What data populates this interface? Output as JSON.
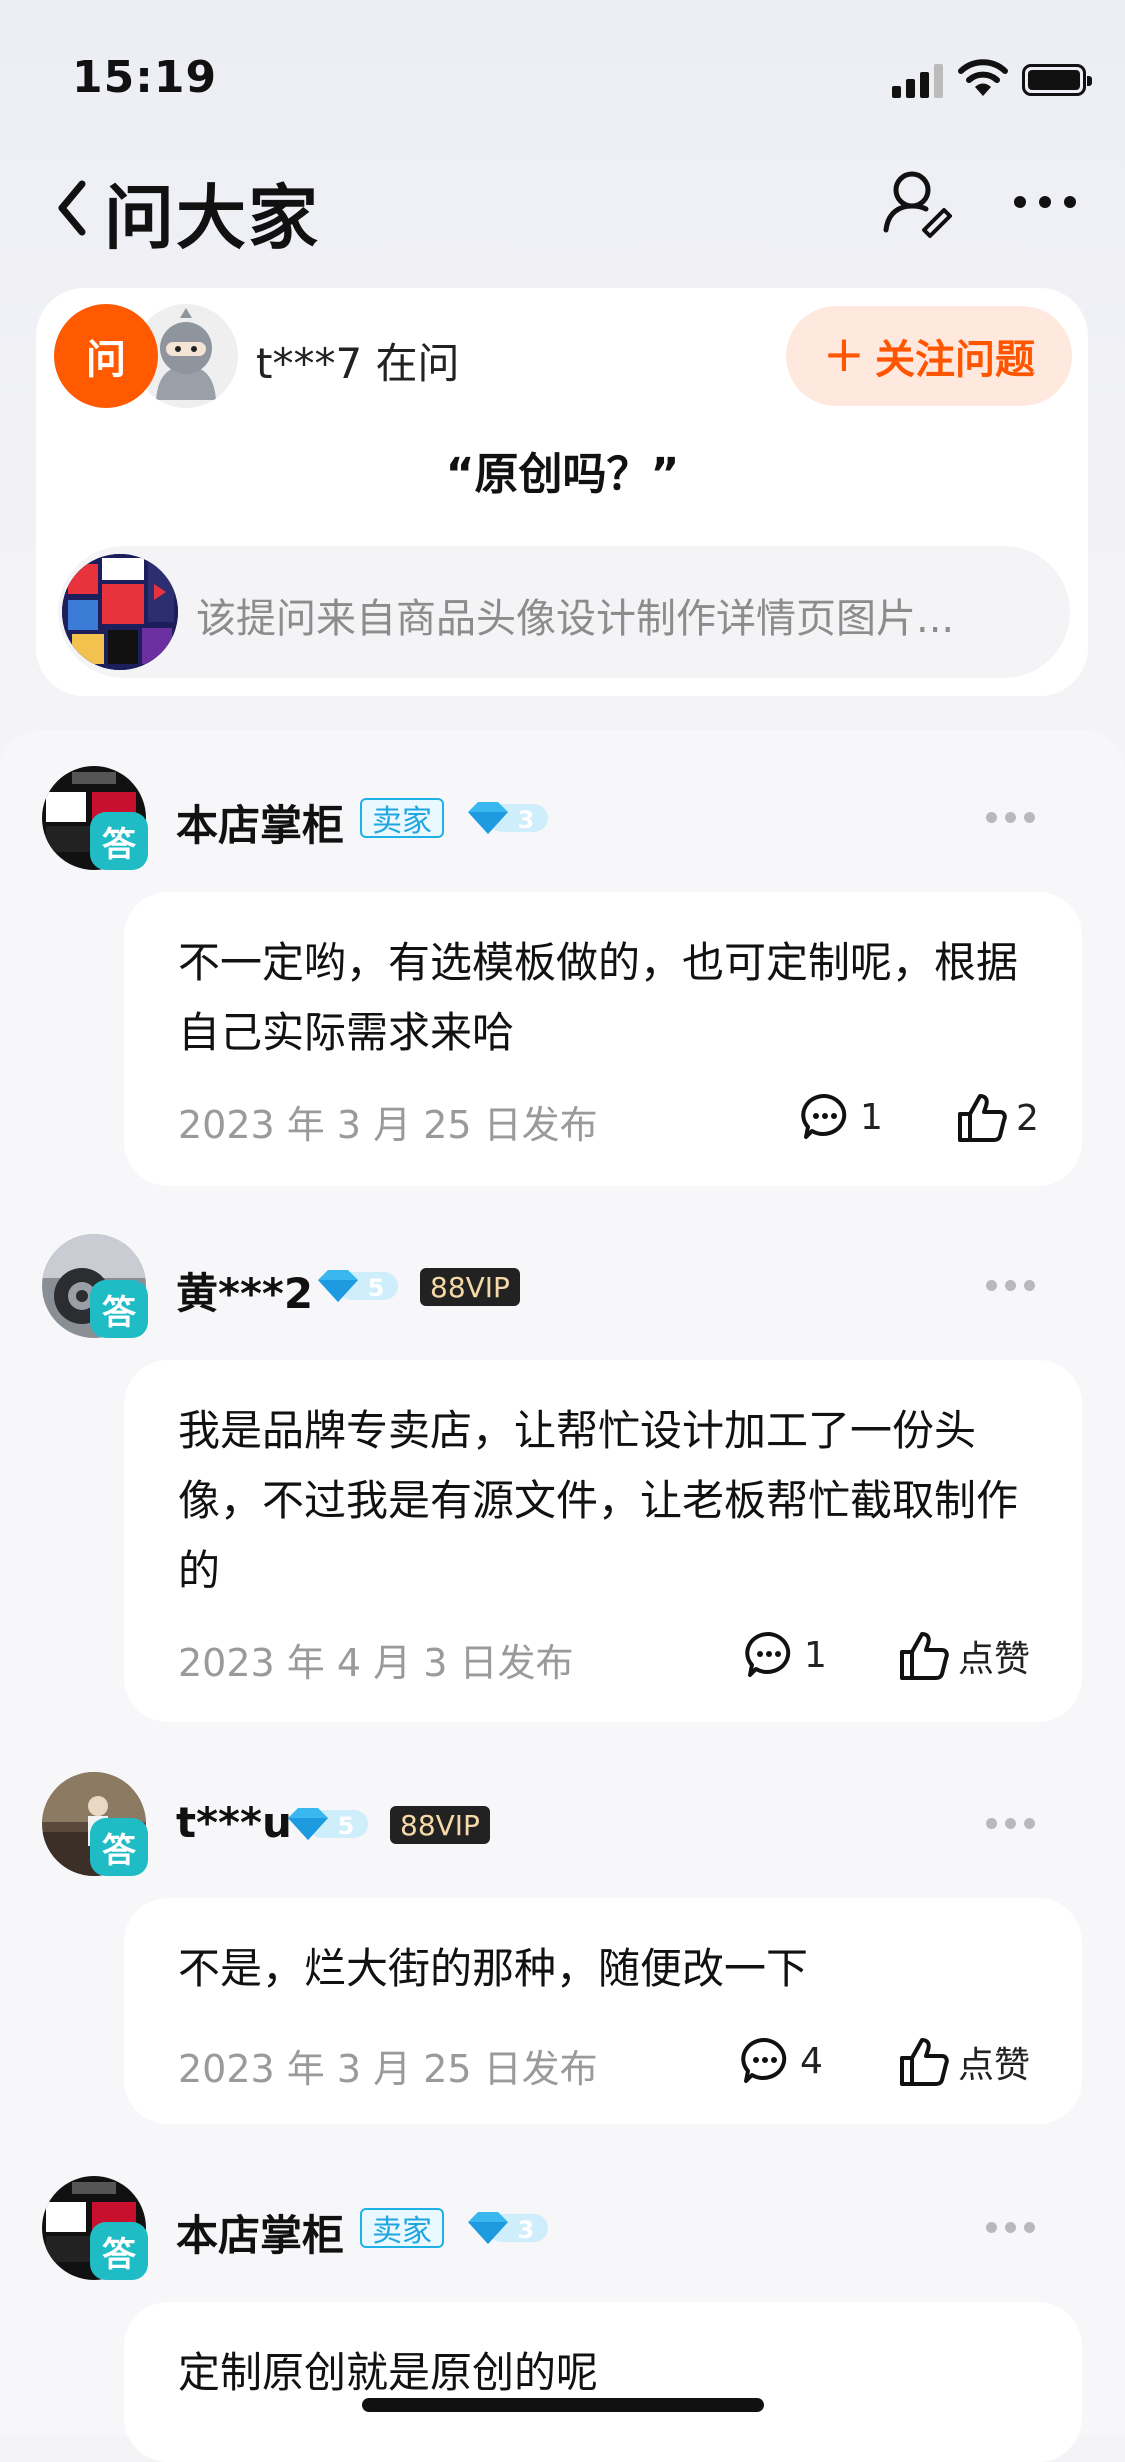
{
  "status": {
    "time": "15:19"
  },
  "nav": {
    "title": "问大家"
  },
  "question": {
    "badge": "问",
    "asker": "t***7 在问",
    "follow_label": "关注问题",
    "follow_plus": "+",
    "text": "“原创吗？”",
    "source": "该提问来自商品头像设计制作详情页图片..."
  },
  "answers": [
    {
      "user": "本店掌柜",
      "seller_badge": "卖家",
      "level": "3",
      "vip": "",
      "tag": "答",
      "text": "不一定哟，有选模板做的，也可定制呢，根据自己实际需求来哈",
      "date": "2023 年 3 月 25 日发布",
      "comments": "1",
      "likes": "2"
    },
    {
      "user": "黄***2",
      "seller_badge": "",
      "level": "5",
      "vip": "88VIP",
      "tag": "答",
      "text": "我是品牌专卖店，让帮忙设计加工了一份头像，不过我是有源文件，让老板帮忙截取制作的",
      "date": "2023 年 4 月 3 日发布",
      "comments": "1",
      "likes": "点赞"
    },
    {
      "user": "t***u",
      "seller_badge": "",
      "level": "5",
      "vip": "88VIP",
      "tag": "答",
      "text": "不是，烂大街的那种，随便改一下",
      "date": "2023 年 3 月 25 日发布",
      "comments": "4",
      "likes": "点赞"
    },
    {
      "user": "本店掌柜",
      "seller_badge": "卖家",
      "level": "3",
      "vip": "",
      "tag": "答",
      "text": "定制原创就是原创的呢"
    }
  ],
  "colors": {
    "accent": "#ff5a00",
    "answer_tag": "#1fbcc6",
    "seller": "#1fa6e0"
  }
}
